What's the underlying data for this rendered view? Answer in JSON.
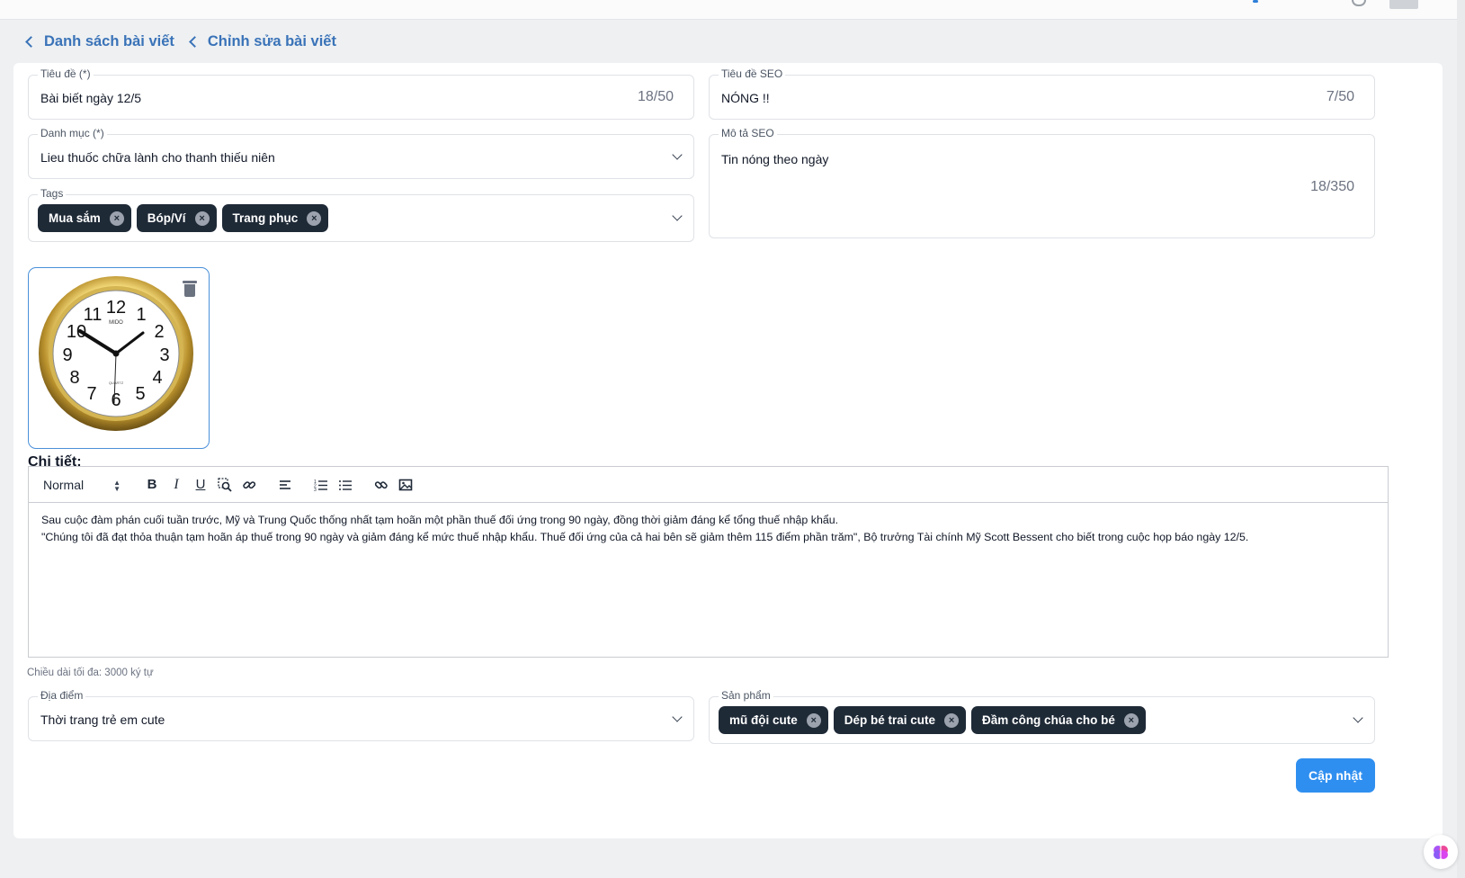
{
  "breadcrumb": {
    "items": [
      "Danh sách bài viết",
      "Chỉnh sửa bài viết"
    ]
  },
  "form": {
    "title": {
      "label": "Tiêu đề (*)",
      "value": "Bài biết ngày 12/5",
      "counter": "18/50"
    },
    "seo_title": {
      "label": "Tiêu đề SEO",
      "value": "NÓNG !!",
      "counter": "7/50"
    },
    "category": {
      "label": "Danh mục (*)",
      "value": "Lieu thuốc chữa lành cho thanh thiếu niên"
    },
    "seo_description": {
      "label": "Mô tả SEO",
      "value": "Tin nóng theo ngày",
      "counter": "18/350"
    },
    "tags": {
      "label": "Tags",
      "chips": [
        "Mua sắm",
        "Bóp/Ví",
        "Trang phục"
      ]
    },
    "detail": {
      "label": "Chi tiết:",
      "format": "Normal",
      "paragraphs": [
        "Sau cuộc đàm phán cuối tuần trước, Mỹ và Trung Quốc thống nhất tạm hoãn một phần thuế đối ứng trong 90 ngày, đồng thời giảm đáng kể tổng thuế nhập khẩu.",
        "\"Chúng tôi đã đạt thỏa thuận tạm hoãn áp thuế trong 90 ngày và giảm đáng kể mức thuế nhập khẩu. Thuế đối ứng của cả hai bên sẽ giảm thêm 115 điểm phần trăm\", Bộ trưởng Tài chính Mỹ Scott Bessent cho biết trong cuộc họp báo ngày 12/5."
      ],
      "hint": "Chiều dài tối đa: 3000 ký tự"
    },
    "location": {
      "label": "Địa điểm",
      "value": "Thời trang trẻ em cute"
    },
    "products": {
      "label": "Sản phẩm",
      "chips": [
        "mũ đội cute",
        "Dép bé trai cute",
        "Đầm công chúa cho bé"
      ]
    },
    "submit_label": "Cập nhật"
  },
  "image": {
    "brand": "MIDO",
    "dial": [
      "12",
      "1",
      "2",
      "3",
      "4",
      "5",
      "6",
      "7",
      "8",
      "9",
      "10",
      "11"
    ],
    "sub": "QUARTZ"
  },
  "icons": {
    "toolbar": [
      "bold-icon",
      "italic-icon",
      "underline-icon",
      "find-icon",
      "unlink-icon",
      "align-left-icon",
      "ordered-list-icon",
      "bullet-list-icon",
      "link-icon",
      "image-icon"
    ]
  }
}
